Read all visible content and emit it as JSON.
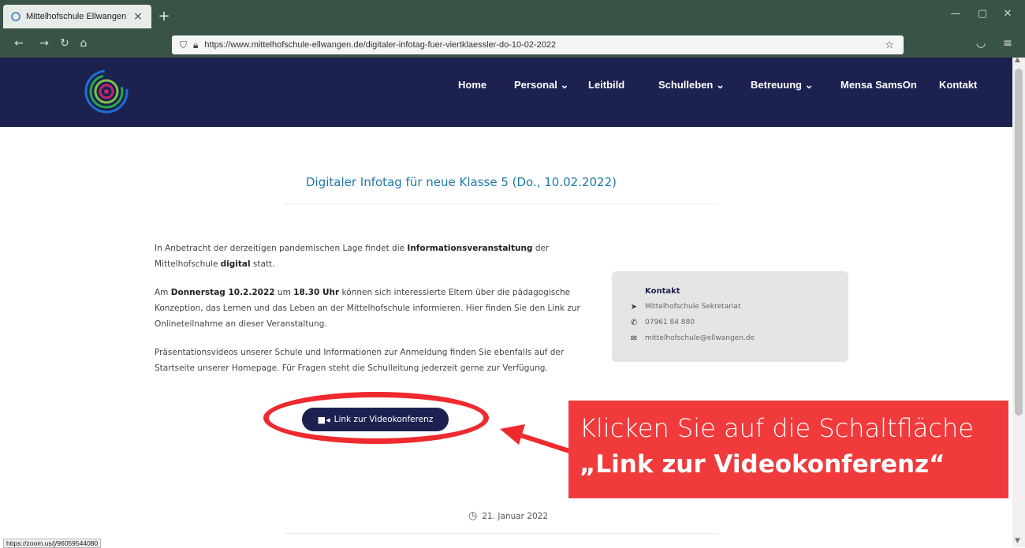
{
  "browser": {
    "tab_title": "Mittelhofschule Ellwangen",
    "tab_close": "×",
    "new_tab": "+",
    "url": "https://www.mittelhofschule-ellwangen.de/digitaler-infotag-fuer-viertklaessler-do-10-02-2022",
    "status_url": "https://zoom.us/j/96059544080",
    "window_controls": [
      "minimize-icon",
      "maximize-icon",
      "close-icon"
    ],
    "nav_icons": [
      "back-icon",
      "forward-icon",
      "reload-icon",
      "home-icon"
    ],
    "toolbar_icons": [
      "shield-icon",
      "lock-icon",
      "bookmark-star-icon",
      "pocket-icon",
      "menu-icon"
    ]
  },
  "site": {
    "nav": [
      {
        "label": "Home"
      },
      {
        "label": "Personal ⌄"
      },
      {
        "label": "Leitbild"
      },
      {
        "label": "Schulleben ⌄"
      },
      {
        "label": "Betreuung ⌄"
      },
      {
        "label": "Mensa SamsOn"
      },
      {
        "label": "Kontakt"
      }
    ],
    "colors": {
      "header": "#1c2150",
      "title": "#1f79a8",
      "callout": "#f03a3c"
    }
  },
  "article": {
    "title": "Digitaler Infotag für neue Klasse 5 (Do., 10.02.2022)",
    "p1_a": "In Anbetracht der derzeitigen pandemischen Lage findet die ",
    "p1_b": "Informationsveranstaltung",
    "p1_c": " der Mittelhofschule ",
    "p1_d": "digital",
    "p1_e": " statt.",
    "p2_a": "Am ",
    "p2_b": "Donnerstag 10.2.2022",
    "p2_c": " um ",
    "p2_d": "18.30 Uhr",
    "p2_e": " können sich interessierte Eltern über die pädagogische Konzeption, das Lernen und das Leben an der Mittelhofschule informieren. Hier finden Sie den Link zur Onlineteilnahme an dieser Veranstaltung.",
    "p3": "Präsentationsvideos unserer Schule und Informationen zur Anmeldung finden Sie ebenfalls auf der Startseite unserer Homepage. Für Fragen steht die Schulleitung jederzeit gerne zur Verfügung.",
    "button_label": "Link zur Videokonferenz",
    "date": "21. Januar 2022"
  },
  "contact": {
    "title": "Kontakt",
    "name": "Mittelhofschule Sekretariat",
    "phone": "07961 84 880",
    "email": "mittelhofschule@ellwangen.de"
  },
  "callout": {
    "line1": "Klicken Sie auf die Schaltfläche",
    "line2": "„Link zur Videokonferenz“"
  }
}
